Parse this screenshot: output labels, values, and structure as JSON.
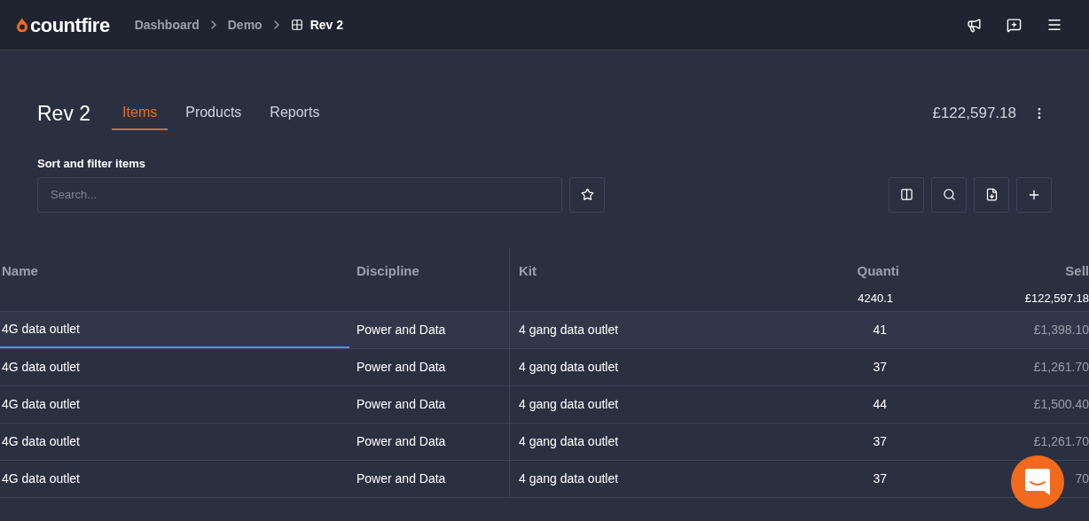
{
  "header": {
    "logo": "countfire",
    "breadcrumbs": [
      {
        "label": "Dashboard",
        "current": false
      },
      {
        "label": "Demo",
        "current": false
      },
      {
        "label": "Rev 2",
        "current": true
      }
    ]
  },
  "page": {
    "title": "Rev 2",
    "tabs": [
      {
        "label": "Items",
        "selected": true
      },
      {
        "label": "Products",
        "selected": false
      },
      {
        "label": "Reports",
        "selected": false
      }
    ],
    "total": "£122,597.18"
  },
  "filter": {
    "label": "Sort and filter items",
    "placeholder": "Search..."
  },
  "table": {
    "columns": [
      "Name",
      "Discipline",
      "Kit",
      "Quanti",
      "Sell"
    ],
    "totals": {
      "quantity": "4240.1",
      "sell": "£122,597.18"
    },
    "rows": [
      {
        "name": "4G data outlet",
        "discipline": "Power and Data",
        "kit": "4 gang data outlet",
        "quantity": "41",
        "sell": "£1,398.10",
        "selected": true
      },
      {
        "name": "4G data outlet",
        "discipline": "Power and Data",
        "kit": "4 gang data outlet",
        "quantity": "37",
        "sell": "£1,261.70",
        "selected": false
      },
      {
        "name": "4G data outlet",
        "discipline": "Power and Data",
        "kit": "4 gang data outlet",
        "quantity": "44",
        "sell": "£1,500.40",
        "selected": false
      },
      {
        "name": "4G data outlet",
        "discipline": "Power and Data",
        "kit": "4 gang data outlet",
        "quantity": "37",
        "sell": "£1,261.70",
        "selected": false
      },
      {
        "name": "4G data outlet",
        "discipline": "Power and Data",
        "kit": "4 gang data outlet",
        "quantity": "37",
        "sell": "70",
        "selected": false
      }
    ]
  }
}
